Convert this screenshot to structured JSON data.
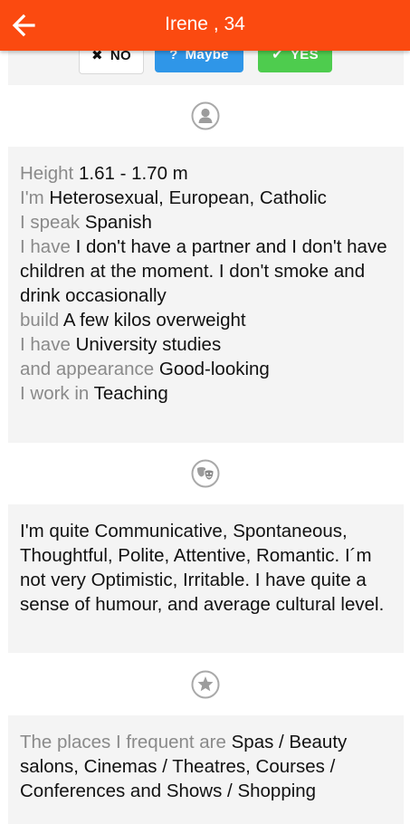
{
  "header": {
    "title": "Irene , 34",
    "back_icon": "arrow-left-icon",
    "background": "#fb4a10"
  },
  "actions": {
    "no_label": "NO",
    "maybe_label": "Maybe",
    "yes_label": "YES",
    "no_icon": "x-icon",
    "maybe_icon": "question-icon",
    "yes_icon": "check-icon"
  },
  "sections": {
    "profile_icon": "person-icon",
    "personality_icon": "theater-masks-icon",
    "interests_icon": "star-icon"
  },
  "profile": {
    "rows": [
      {
        "label": "Height",
        "value": "1.61 - 1.70 m"
      },
      {
        "label": "I'm",
        "value": "Heterosexual, European, Catholic"
      },
      {
        "label": "I speak",
        "value": "Spanish"
      },
      {
        "label": "I have",
        "value": "I don't have a partner and I don't have children at the moment. I don't smoke and drink occasionally"
      },
      {
        "label": "build",
        "value": "A few kilos overweight"
      },
      {
        "label": "I have",
        "value": "University studies"
      },
      {
        "label": "and appearance",
        "value": "Good-looking"
      },
      {
        "label": "I work in",
        "value": "Teaching"
      }
    ]
  },
  "personality": {
    "text": "I'm quite Communicative, Spontaneous, Thoughtful, Polite, Attentive, Romantic. I´m not very Optimistic, Irritable. I have quite a sense of humour, and average cultural level."
  },
  "interests": {
    "label": "The places I frequent are",
    "value": "Spas / Beauty salons, Cinemas / Theatres, Courses / Conferences and Shows / Shopping"
  }
}
